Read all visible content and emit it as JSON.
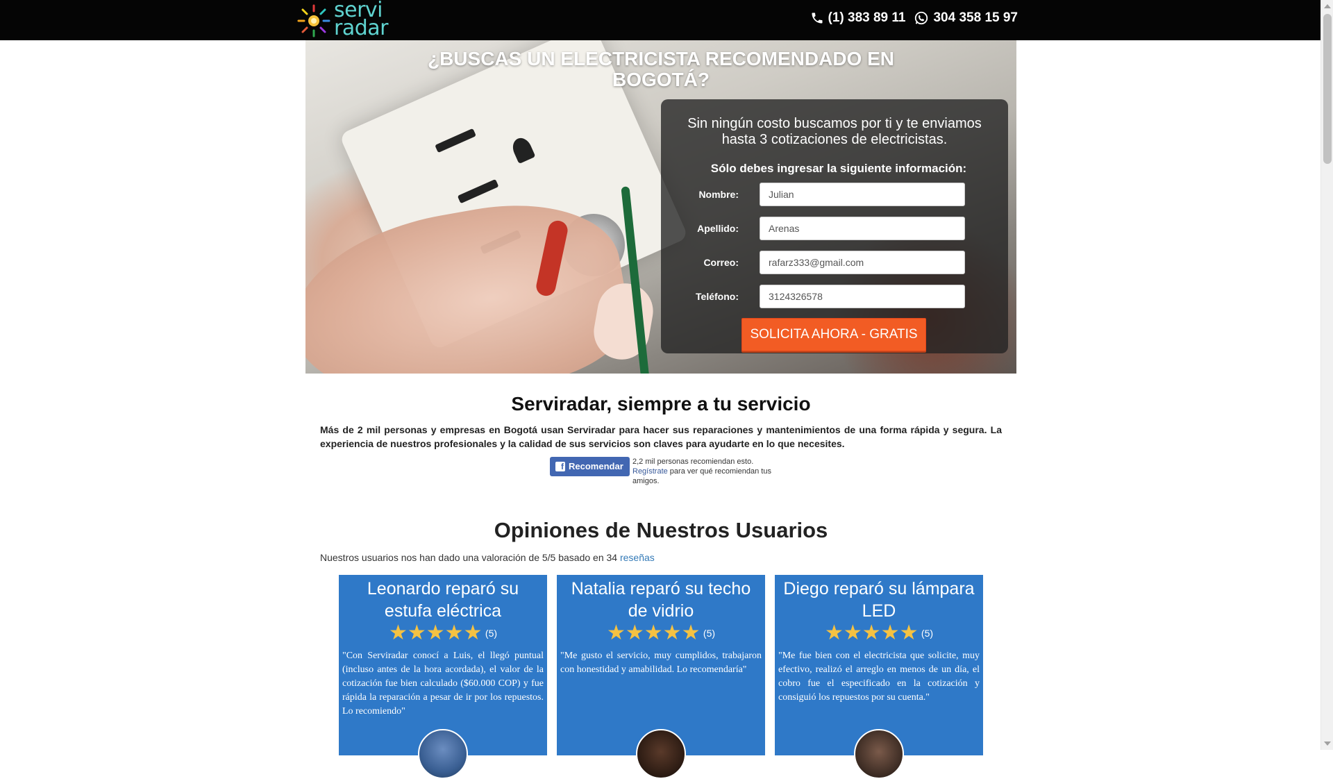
{
  "header": {
    "logo_line1": "servi",
    "logo_line2": "radar",
    "phone": "(1) 383 89 11",
    "whatsapp": "304 358 15 97"
  },
  "hero": {
    "title": "¿BUSCAS UN ELECTRICISTA RECOMENDADO EN BOGOTÁ?",
    "intro": "Sin ningún costo buscamos por ti y te enviamos hasta 3 cotizaciones de electricistas.",
    "sub": "Sólo debes ingresar la siguiente información:",
    "fields": [
      {
        "label": "Nombre:",
        "value": "Julian"
      },
      {
        "label": "Apellido:",
        "value": "Arenas"
      },
      {
        "label": "Correo:",
        "value": "rafarz333@gmail.com"
      },
      {
        "label": "Teléfono:",
        "value": "3124326578"
      }
    ],
    "cta": "SOLICITA AHORA - GRATIS"
  },
  "about": {
    "title": "Serviradar, siempre a tu servicio",
    "text": "Más de 2 mil personas y empresas en Bogotá usan Serviradar para hacer sus reparaciones y mantenimientos de una forma rápida y segura. La experiencia de nuestros profesionales y la calidad de sus servicios son claves para ayudarte en lo que necesites.",
    "fb_button": "Recomendar",
    "fb_count": "2,2 mil personas recomiendan esto.",
    "fb_link": "Regístrate",
    "fb_rest": " para ver qué recomiendan tus amigos."
  },
  "reviews": {
    "title": "Opiniones de Nuestros Usuarios",
    "summary_prefix": "Nuestros usuarios nos han dado una valoración de 5/5 basado en 34 ",
    "summary_link": "reseñas",
    "items": [
      {
        "title": "Leonardo reparó su estufa eléctrica",
        "rating": 5,
        "count": "(5)",
        "text": "\"Con Serviradar conocí a Luis, el llegó puntual (incluso antes de la hora acordada), el valor de la cotización fue bien calculado ($60.000 COP) y fue rápida la reparación a pesar de ir por los repuestos. Lo recomiendo\""
      },
      {
        "title": "Natalia reparó su techo de vidrio",
        "rating": 5,
        "count": "(5)",
        "text": "\"Me gusto el servicio, muy cumplidos, trabajaron con honestidad y amabilidad. Lo recomendaría\""
      },
      {
        "title": "Diego reparó su lámpara LED",
        "rating": 5,
        "count": "(5)",
        "text": "\"Me fue bien con el electricista que solicite, muy efectivo, realizó el arreglo en menos de un día, el cobro fue el especificado en la cotización y consiguió los repuestos por su cuenta.\""
      }
    ]
  },
  "icons": {
    "phone": "phone-icon",
    "whatsapp": "whatsapp-icon",
    "facebook": "facebook-icon",
    "star": "star-icon"
  },
  "colors": {
    "accent_orange": "#f25c24",
    "card_blue": "#2f79c8",
    "logo_teal": "#5fd3d0",
    "star_yellow": "#f5c242"
  }
}
